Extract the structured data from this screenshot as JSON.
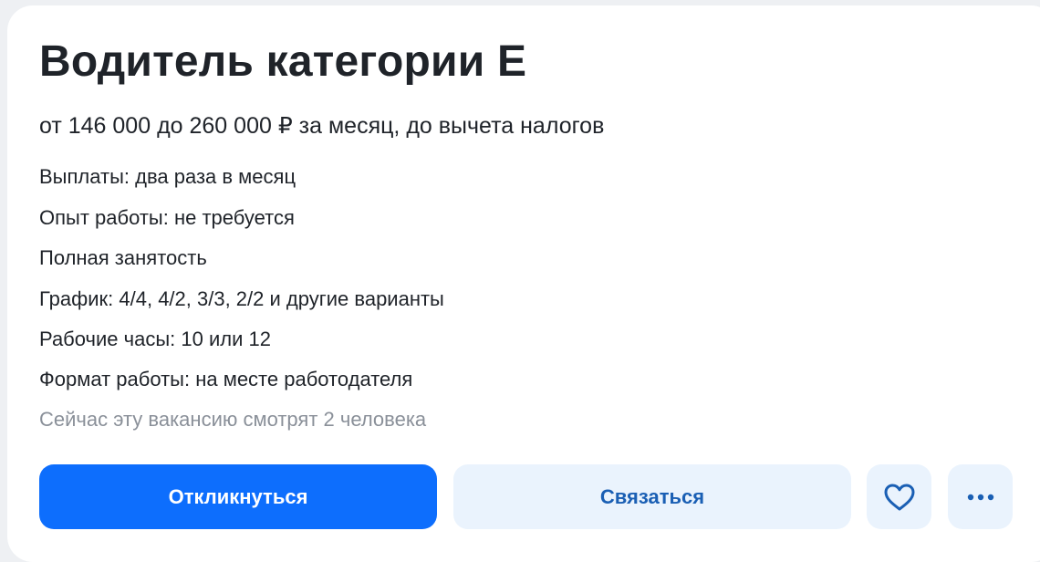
{
  "vacancy": {
    "title": "Водитель категории Е",
    "salary": "от 146 000 до 260 000 ₽ за месяц, до вычета налогов",
    "details": [
      "Выплаты: два раза в месяц",
      "Опыт работы: не требуется",
      "Полная занятость",
      "График: 4/4, 4/2, 3/3, 2/2 и другие варианты",
      "Рабочие часы: 10 или 12",
      "Формат работы: на месте работодателя"
    ],
    "viewers_note": "Сейчас эту вакансию смотрят 2 человека"
  },
  "actions": {
    "apply_label": "Откликнуться",
    "contact_label": "Связаться",
    "favorite_icon": "heart-icon",
    "more_icon": "more-dots-icon"
  },
  "colors": {
    "primary": "#0d6efd",
    "secondary_bg": "#eaf3fd",
    "secondary_text": "#1a5fb4",
    "text": "#1f2329",
    "muted": "#8a9099"
  }
}
